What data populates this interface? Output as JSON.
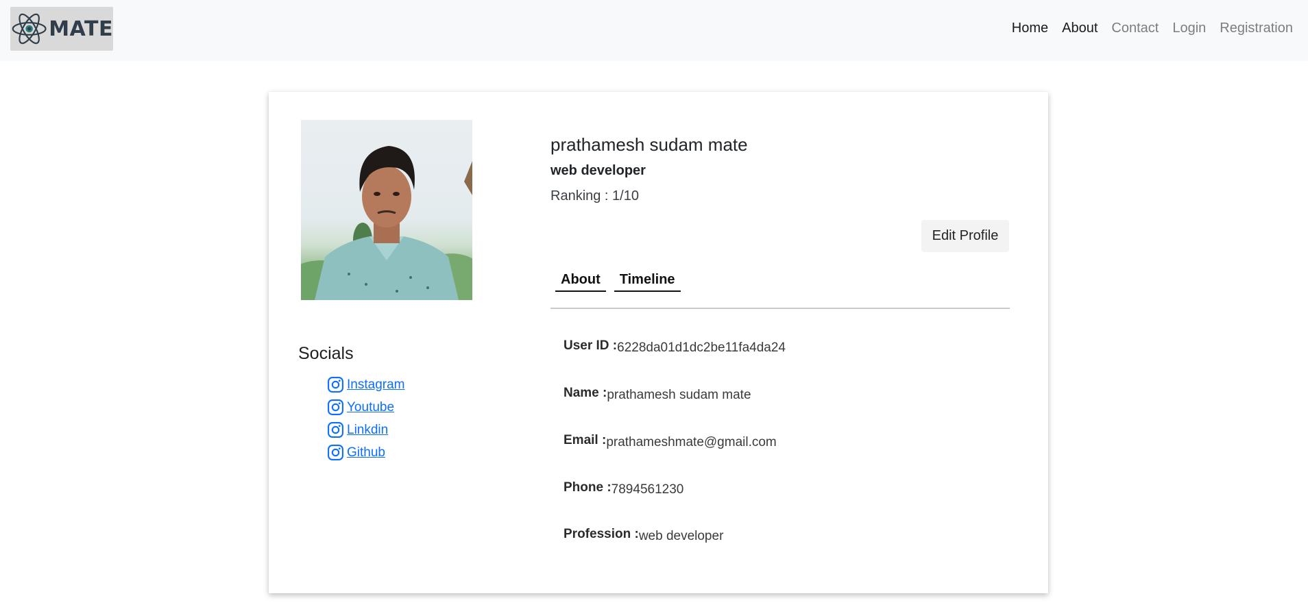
{
  "brand": {
    "name": "MATE"
  },
  "nav": {
    "items": [
      {
        "label": "Home",
        "state": "active"
      },
      {
        "label": "About",
        "state": "active"
      },
      {
        "label": "Contact",
        "state": "muted"
      },
      {
        "label": "Login",
        "state": "muted"
      },
      {
        "label": "Registration",
        "state": "muted"
      }
    ]
  },
  "profile": {
    "name": "prathamesh sudam mate",
    "role": "web developer",
    "ranking": "Ranking : 1/10",
    "edit_label": "Edit Profile"
  },
  "socials": {
    "title": "Socials",
    "items": [
      {
        "label": " Instagram",
        "icon": "instagram-icon"
      },
      {
        "label": " Youtube",
        "icon": "instagram-icon"
      },
      {
        "label": " Linkdin",
        "icon": "instagram-icon"
      },
      {
        "label": " Github",
        "icon": "instagram-icon"
      }
    ]
  },
  "tabs": [
    {
      "label": "About"
    },
    {
      "label": "Timeline"
    }
  ],
  "info": [
    {
      "label": "User ID :",
      "value": "6228da01d1dc2be11fa4da24"
    },
    {
      "label": "Name :",
      "value": "prathamesh sudam mate"
    },
    {
      "label": "Email :",
      "value": "prathameshmate@gmail.com"
    },
    {
      "label": "Phone :",
      "value": "7894561230"
    },
    {
      "label": "Profession :",
      "value": "web developer"
    }
  ],
  "colors": {
    "link": "#0d6efd",
    "navbar_bg": "#f8f9fa"
  }
}
